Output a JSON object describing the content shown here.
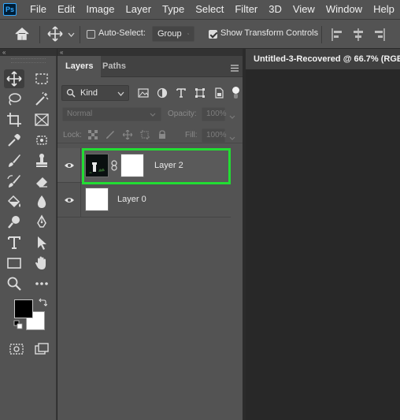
{
  "app": {
    "logo": "Ps"
  },
  "menu": [
    "File",
    "Edit",
    "Image",
    "Layer",
    "Type",
    "Select",
    "Filter",
    "3D",
    "View",
    "Window",
    "Help"
  ],
  "options_bar": {
    "auto_select_label": "Auto-Select:",
    "auto_select_checked": false,
    "group_value": "Group",
    "show_transform_label": "Show Transform Controls",
    "show_transform_checked": true
  },
  "tools": {
    "items": [
      "move-tool",
      "marquee-tool",
      "lasso-tool",
      "magic-wand-tool",
      "crop-tool",
      "frame-tool",
      "eyedropper-tool",
      "patch-tool",
      "brush-tool",
      "stamp-tool",
      "history-brush-tool",
      "eraser-tool",
      "bucket-tool",
      "blur-tool",
      "dodge-tool",
      "pen-tool",
      "type-tool",
      "path-selection-tool",
      "rectangle-tool",
      "hand-tool",
      "zoom-tool",
      "more-tools"
    ],
    "active": "move-tool",
    "foreground_color": "#000000",
    "background_color": "#ffffff"
  },
  "layers_panel": {
    "tabs": [
      "Layers",
      "Paths"
    ],
    "active_tab": "Layers",
    "filter_kind": "Kind",
    "blend_mode": "Normal",
    "opacity_label": "Opacity:",
    "opacity_value": "100%",
    "lock_label": "Lock:",
    "fill_label": "Fill:",
    "fill_value": "100%",
    "layers": [
      {
        "name": "Layer 2",
        "visible": true,
        "has_mask": true,
        "selected": true
      },
      {
        "name": "Layer 0",
        "visible": true,
        "has_mask": false,
        "selected": false
      }
    ],
    "highlight_color": "#22dd33"
  },
  "document": {
    "tab_title": "Untitled-3-Recovered @ 66.7% (RGB"
  }
}
